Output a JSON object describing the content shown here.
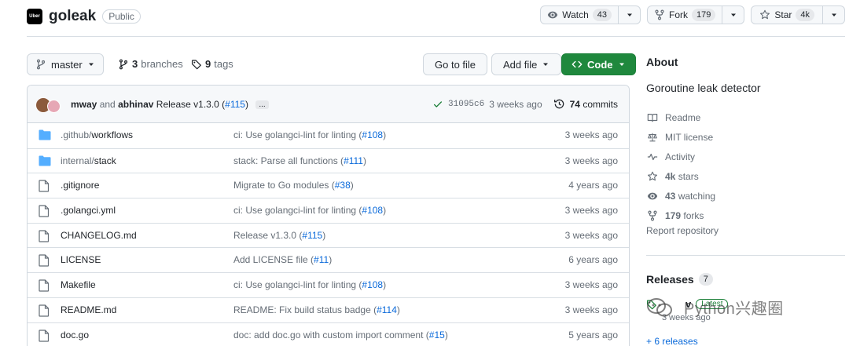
{
  "repo": {
    "logo_text": "Uber",
    "name": "goleak",
    "visibility": "Public"
  },
  "header_actions": {
    "watch_label": "Watch",
    "watch_count": "43",
    "fork_label": "Fork",
    "fork_count": "179",
    "star_label": "Star",
    "star_count": "4k"
  },
  "toolbar": {
    "branch": "master",
    "branches_count": "3",
    "branches_label": "branches",
    "tags_count": "9",
    "tags_label": "tags",
    "go_to_file": "Go to file",
    "add_file": "Add file",
    "code": "Code"
  },
  "latest_commit": {
    "author1": "mway",
    "and": "and",
    "author2": "abhinav",
    "message": "Release v1.3.0 (",
    "pr": "#115",
    "message_end": ")",
    "ellipsis": "...",
    "sha": "31095c6",
    "age": "3 weeks ago",
    "commits_count": "74",
    "commits_label": "commits"
  },
  "files": [
    {
      "type": "dir",
      "name_prefix": ".github/",
      "name_main": "workflows",
      "msg": "ci: Use golangci-lint for linting (",
      "pr": "#108",
      "msg_end": ")",
      "age": "3 weeks ago"
    },
    {
      "type": "dir",
      "name_prefix": "internal/",
      "name_main": "stack",
      "msg": "stack: Parse all functions (",
      "pr": "#111",
      "msg_end": ")",
      "age": "3 weeks ago"
    },
    {
      "type": "file",
      "name_prefix": "",
      "name_main": ".gitignore",
      "msg": "Migrate to Go modules (",
      "pr": "#38",
      "msg_end": ")",
      "age": "4 years ago"
    },
    {
      "type": "file",
      "name_prefix": "",
      "name_main": ".golangci.yml",
      "msg": "ci: Use golangci-lint for linting (",
      "pr": "#108",
      "msg_end": ")",
      "age": "3 weeks ago"
    },
    {
      "type": "file",
      "name_prefix": "",
      "name_main": "CHANGELOG.md",
      "msg": "Release v1.3.0 (",
      "pr": "#115",
      "msg_end": ")",
      "age": "3 weeks ago"
    },
    {
      "type": "file",
      "name_prefix": "",
      "name_main": "LICENSE",
      "msg": "Add LICENSE file (",
      "pr": "#11",
      "msg_end": ")",
      "age": "6 years ago"
    },
    {
      "type": "file",
      "name_prefix": "",
      "name_main": "Makefile",
      "msg": "ci: Use golangci-lint for linting (",
      "pr": "#108",
      "msg_end": ")",
      "age": "3 weeks ago"
    },
    {
      "type": "file",
      "name_prefix": "",
      "name_main": "README.md",
      "msg": "README: Fix build status badge (",
      "pr": "#114",
      "msg_end": ")",
      "age": "3 weeks ago"
    },
    {
      "type": "file",
      "name_prefix": "",
      "name_main": "doc.go",
      "msg": "doc: add doc.go with custom import comment (",
      "pr": "#15",
      "msg_end": ")",
      "age": "5 years ago"
    }
  ],
  "about": {
    "title": "About",
    "description": "Goroutine leak detector",
    "readme": "Readme",
    "license": "MIT license",
    "activity": "Activity",
    "stars_count": "4k",
    "stars_label": "stars",
    "watching_count": "43",
    "watching_label": "watching",
    "forks_count": "179",
    "forks_label": "forks",
    "report": "Report repository"
  },
  "releases": {
    "title": "Releases",
    "count": "7",
    "latest_prefix": "v",
    "latest_badge": "Latest",
    "latest_date": "3 weeks ago",
    "more": "+ 6 releases"
  },
  "watermark": {
    "text": "Python兴趣圈"
  },
  "colors": {
    "accent": "#0969da",
    "primary_button": "#1f883d",
    "folder": "#54aeff",
    "muted": "#656d76"
  },
  "icons": {
    "watch": "eye-icon",
    "fork": "repo-forked-icon",
    "star": "star-icon",
    "branch": "git-branch-icon",
    "tag": "tag-icon",
    "code": "code-icon",
    "check": "check-icon",
    "history": "history-icon",
    "folder": "folder-icon",
    "file": "file-icon",
    "readme": "book-icon",
    "license": "law-icon",
    "activity": "pulse-icon"
  }
}
